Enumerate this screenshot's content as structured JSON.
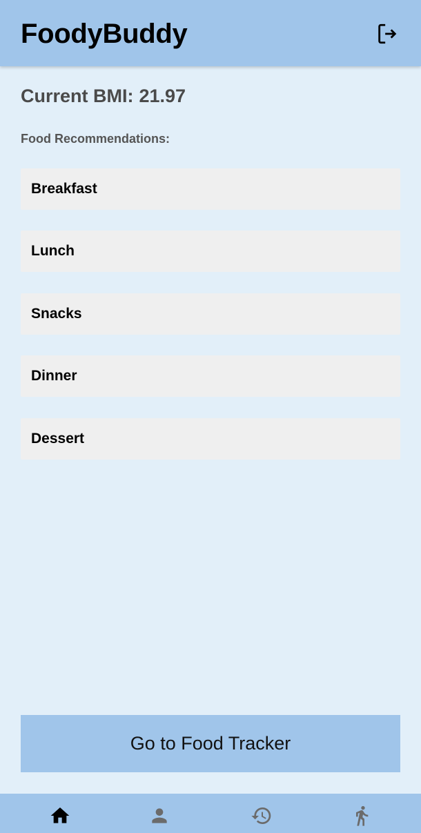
{
  "app": {
    "title": "FoodyBuddy"
  },
  "header": {
    "logout_icon": "logout-icon"
  },
  "bmi": {
    "label": "Current BMI:",
    "value": "21.97"
  },
  "recommendations": {
    "label": "Food Recommendations:",
    "meals": [
      {
        "label": "Breakfast"
      },
      {
        "label": "Lunch"
      },
      {
        "label": "Snacks"
      },
      {
        "label": "Dinner"
      },
      {
        "label": "Dessert"
      }
    ]
  },
  "tracker_button": {
    "label": "Go to Food Tracker"
  },
  "bottom_nav": {
    "items": [
      {
        "icon": "home-icon",
        "active": true
      },
      {
        "icon": "person-icon",
        "active": false
      },
      {
        "icon": "history-icon",
        "active": false
      },
      {
        "icon": "walk-icon",
        "active": false
      }
    ]
  },
  "colors": {
    "app_bar": "#a0c5ea",
    "background": "#e2eff9",
    "card": "#efefef",
    "nav_active": "#000000",
    "nav_inactive": "#6b6b6b"
  }
}
